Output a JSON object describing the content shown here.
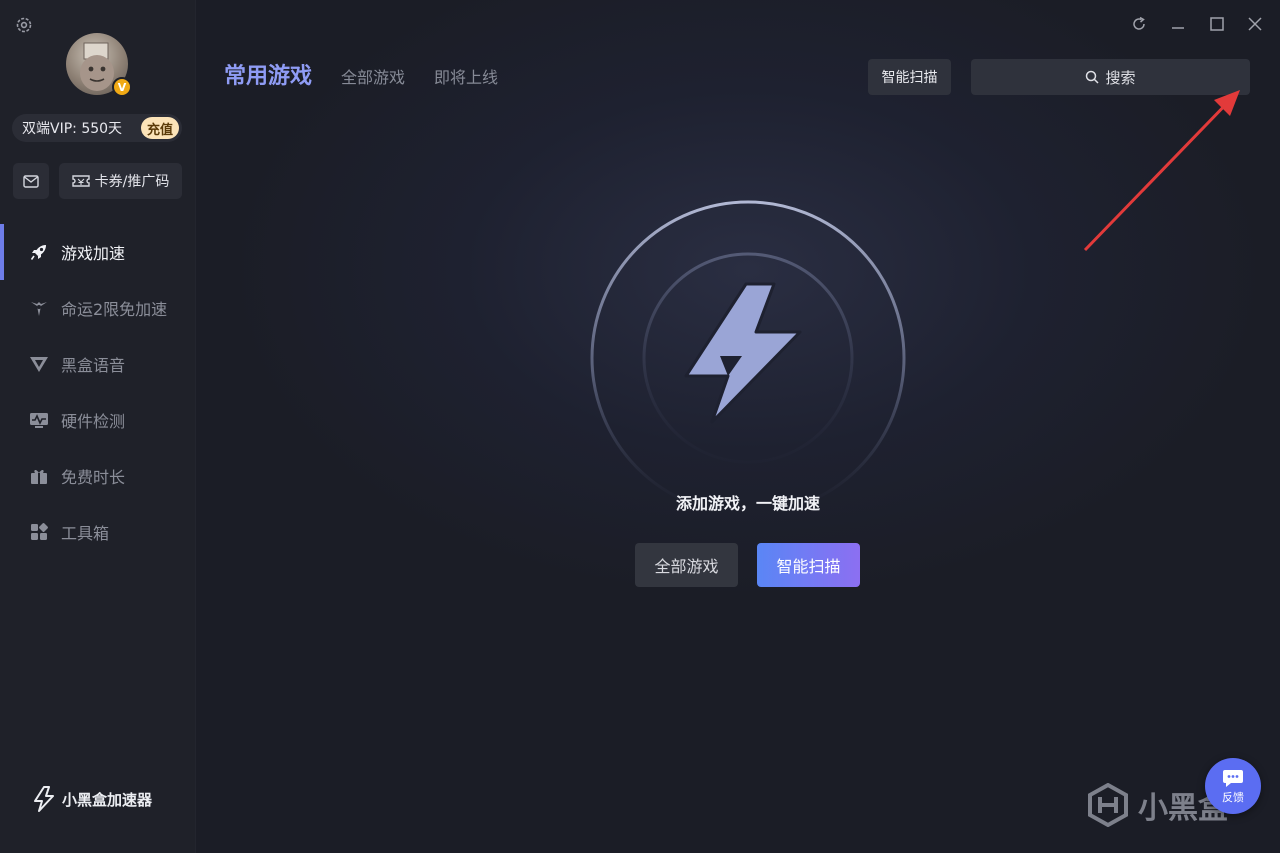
{
  "sidebar": {
    "vip_text": "双端VIP: 550天",
    "recharge_label": "充值",
    "avatar_badge": "V",
    "coupon_label": "卡券/推广码",
    "items": [
      {
        "label": "游戏加速",
        "icon": "rocket-icon",
        "active": true
      },
      {
        "label": "命运2限免加速",
        "icon": "destiny-icon",
        "active": false
      },
      {
        "label": "黑盒语音",
        "icon": "voice-icon",
        "active": false
      },
      {
        "label": "硬件检测",
        "icon": "hardware-icon",
        "active": false
      },
      {
        "label": "免费时长",
        "icon": "gift-icon",
        "active": false
      },
      {
        "label": "工具箱",
        "icon": "toolbox-icon",
        "active": false
      }
    ],
    "brand_name": "小黑盒加速器"
  },
  "header": {
    "tabs": [
      {
        "label": "常用游戏",
        "active": true
      },
      {
        "label": "全部游戏",
        "active": false
      },
      {
        "label": "即将上线",
        "active": false
      }
    ],
    "scan_label": "智能扫描",
    "search_label": "搜索"
  },
  "main": {
    "empty_text": "添加游戏，一键加速",
    "btn_all_games": "全部游戏",
    "btn_smart_scan": "智能扫描"
  },
  "overlay": {
    "watermark": "小黑盒",
    "feedback_label": "反馈"
  },
  "colors": {
    "accent": "#8f9cf5",
    "active_bar": "#6e7de8",
    "scan_gradient_start": "#5a86f5",
    "scan_gradient_end": "#8c6ff2",
    "arrow": "#e23a3a"
  }
}
